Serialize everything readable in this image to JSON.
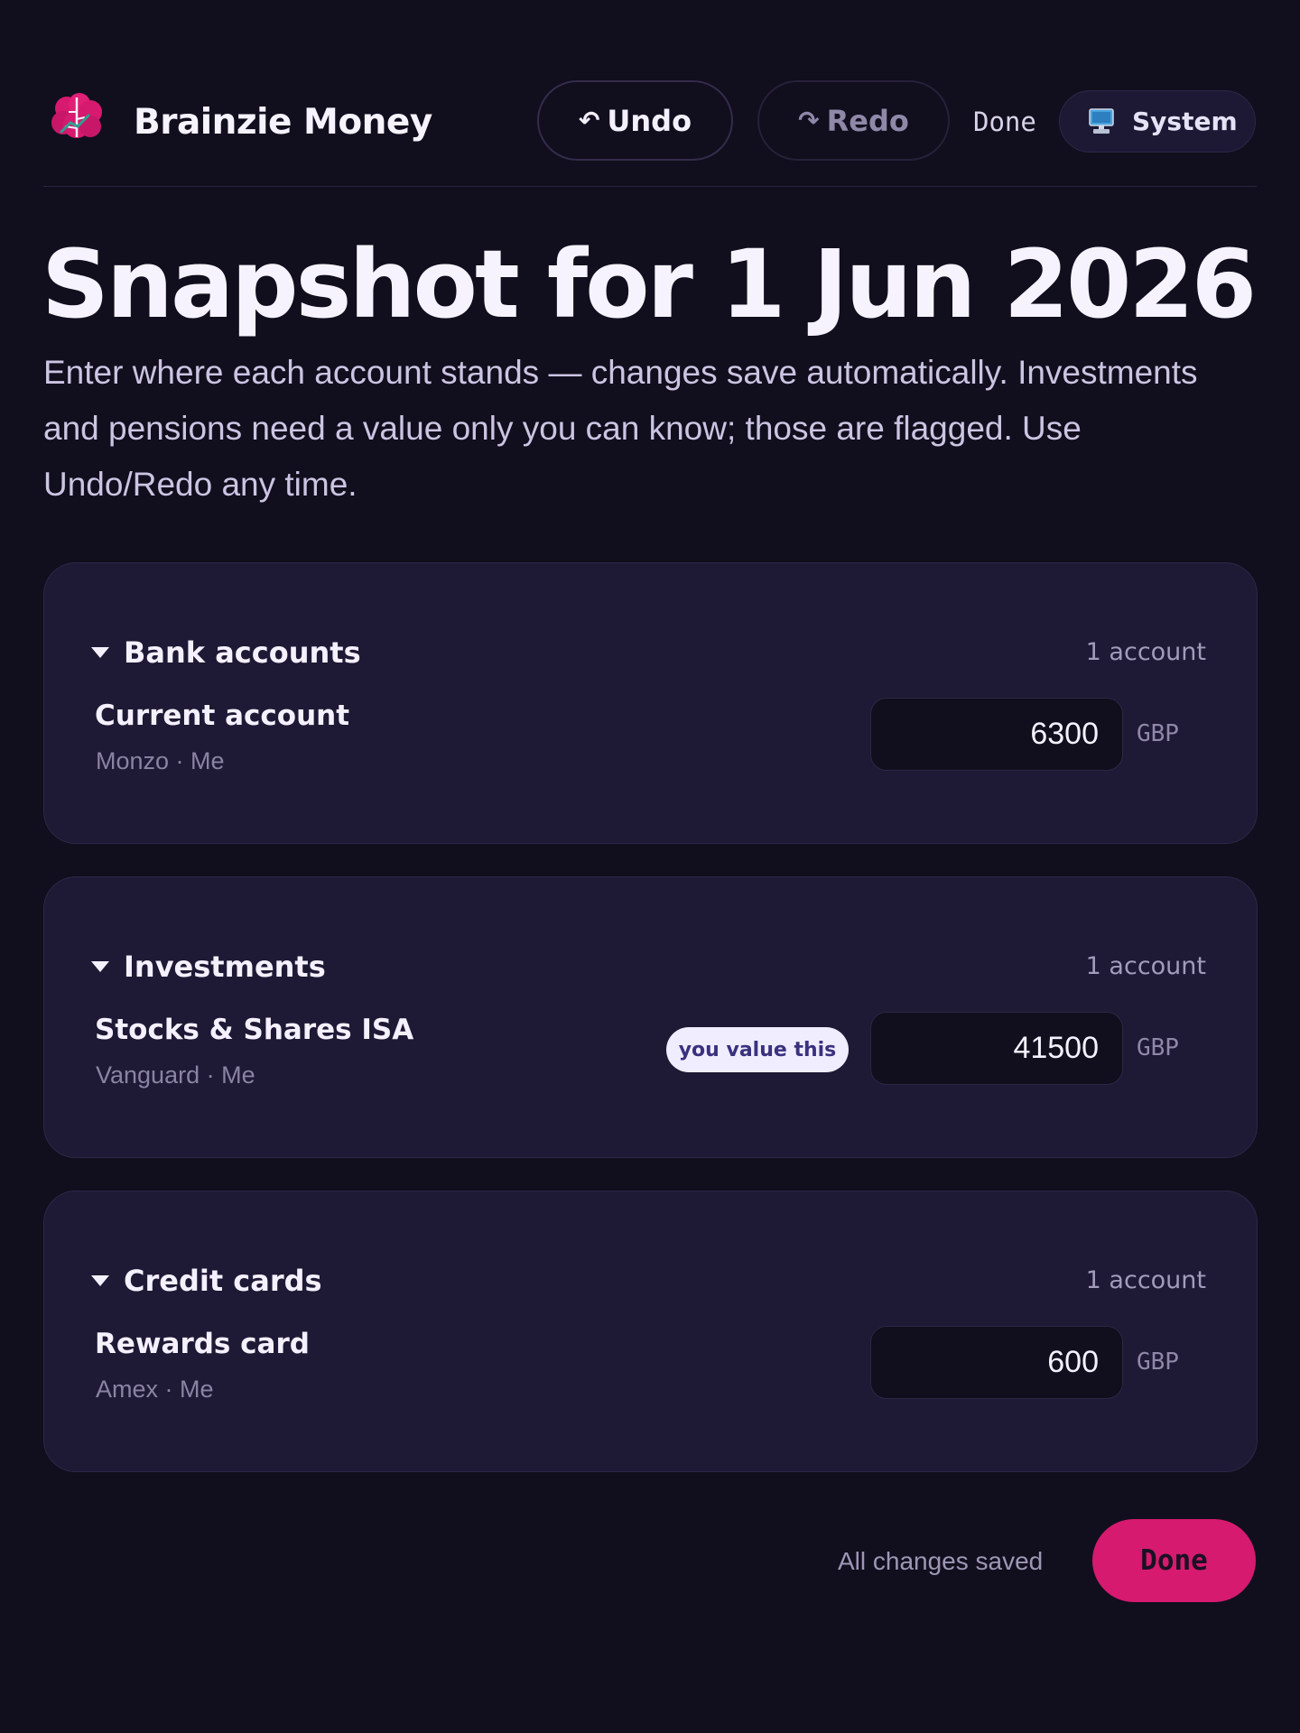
{
  "header": {
    "app_title": "Brainzie Money",
    "logo_icon": "brain-logo-icon",
    "undo": {
      "glyph": "↶",
      "label": "Undo"
    },
    "redo": {
      "glyph": "↷",
      "label": "Redo"
    },
    "done_link": "Done",
    "theme": {
      "icon": "monitor-icon",
      "label": "System"
    }
  },
  "page": {
    "title": "Snapshot for 1 Jun 2026",
    "intro": "Enter where each account stands — changes save automatically. Investments and pensions need a value only you can know; those are flagged. Use Undo/Redo any time."
  },
  "groups": [
    {
      "title": "Bank accounts",
      "count": "1 account",
      "account": {
        "name": "Current account",
        "sub": "Monzo · Me",
        "value": "6300",
        "currency": "GBP"
      }
    },
    {
      "title": "Investments",
      "count": "1 account",
      "account": {
        "name": "Stocks & Shares ISA",
        "sub": "Vanguard · Me",
        "badge": "you value this",
        "value": "41500",
        "currency": "GBP"
      }
    },
    {
      "title": "Credit cards",
      "count": "1 account",
      "account": {
        "name": "Rewards card",
        "sub": "Amex · Me",
        "value": "600",
        "currency": "GBP"
      }
    }
  ],
  "footer": {
    "status": "All changes saved",
    "done_label": "Done"
  },
  "colors": {
    "background": "#110e1d",
    "card": "#1e1934",
    "accent": "#d61a6f",
    "badge_bg": "#efedff"
  }
}
